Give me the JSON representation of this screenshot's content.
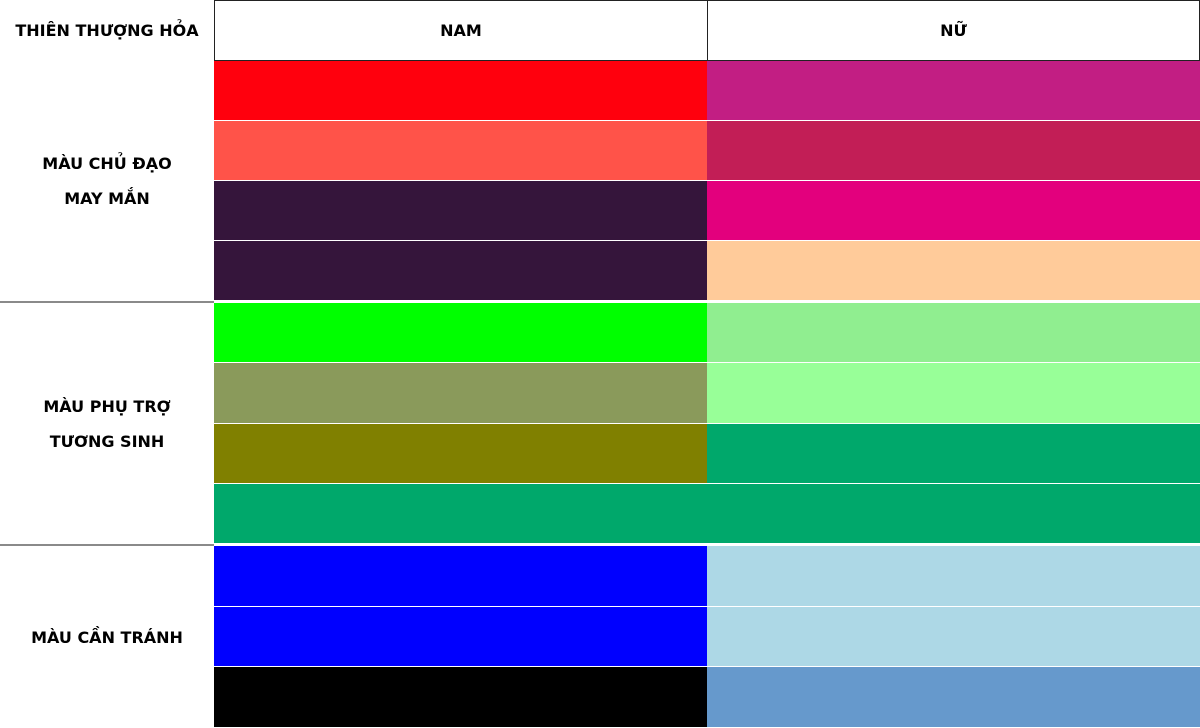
{
  "header": {
    "element": "THIÊN THƯỢNG HỎA",
    "male": "NAM",
    "female": "NỮ"
  },
  "groups": [
    {
      "label": "MÀU CHỦ ĐẠO\nMAY MẮN",
      "male": [
        "#FF000D",
        "#FF5349",
        "#35153B",
        "#35153B"
      ],
      "female": [
        "#C21E83",
        "#C21E56",
        "#E3007D",
        "#FFCB9A"
      ]
    },
    {
      "label": "MÀU PHỤ TRỢ\nTƯƠNG SINH",
      "male": [
        "#00FF00",
        "#8A9A5B",
        "#808000",
        "#00A86B"
      ],
      "female": [
        "#90EE90",
        "#98FF98",
        "#00A86B",
        "#00A86B"
      ]
    },
    {
      "label": "MÀU CẦN TRÁNH",
      "male": [
        "#0000FF",
        "#0000FF",
        "#000000"
      ],
      "female": [
        "#ADD8E6",
        "#ADD8E6",
        "#6699CC"
      ]
    }
  ]
}
